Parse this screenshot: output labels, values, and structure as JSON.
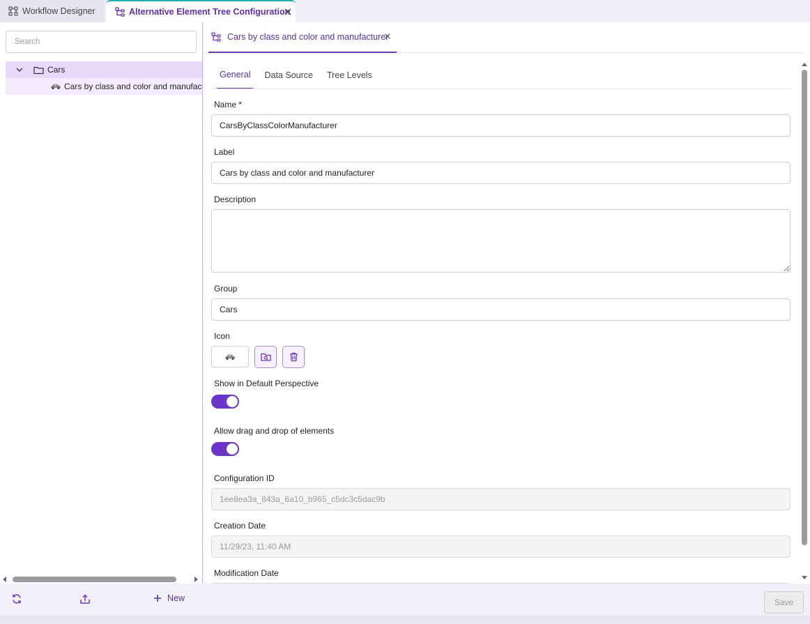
{
  "top_tabs": [
    {
      "label": "Workflow Designer",
      "icon": "workflow-icon"
    },
    {
      "label": "Alternative Element Tree Configuration",
      "icon": "tree-config-icon",
      "active": true
    }
  ],
  "left": {
    "search_placeholder": "Search",
    "tree": {
      "folder": {
        "label": "Cars",
        "icon": "folder-icon",
        "expanded": true
      },
      "child": {
        "label": "Cars by class and color and manufacturer",
        "icon": "car-icon"
      }
    },
    "footer": {
      "new_label": "New"
    }
  },
  "editor": {
    "tab_label": "Cars by class and color and manufacturer",
    "subtabs": [
      "General",
      "Data Source",
      "Tree Levels"
    ],
    "active_subtab": "General",
    "fields": {
      "name_label": "Name *",
      "name_value": "CarsByClassColorManufacturer",
      "label_label": "Label",
      "label_value": "Cars by class and color and manufacturer",
      "description_label": "Description",
      "description_value": "",
      "group_label": "Group",
      "group_value": "Cars",
      "icon_label": "Icon",
      "show_default_label": "Show in Default Perspective",
      "show_default_on": true,
      "allow_dnd_label": "Allow drag and drop of elements",
      "allow_dnd_on": true,
      "config_id_label": "Configuration ID",
      "config_id_value": "1ee8ea3a_843a_6a10_b965_c5dc3c5dac9b",
      "creation_label": "Creation Date",
      "creation_value": "11/29/23, 11:40 AM",
      "modification_label": "Modification Date"
    },
    "save_label": "Save"
  },
  "colors": {
    "accent": "#6c35c9",
    "accent_light": "#ead9fb",
    "tab_top_border": "#16b7b3"
  }
}
